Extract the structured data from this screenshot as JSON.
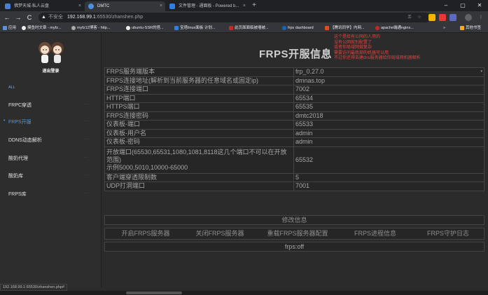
{
  "browser": {
    "tabs": [
      {
        "title": "佛梦天城-私人云盘",
        "icon_color": "#4a7fd8",
        "close": "×"
      },
      {
        "title": "DMTC",
        "icon_color": "#4a90e2",
        "close": "×"
      },
      {
        "title": "文件管理 - 通面板 - Powered b...",
        "icon_color": "#2d7fe0",
        "close": "×"
      }
    ],
    "new_tab": "+",
    "window_controls": [
      "–",
      "▢",
      "✕"
    ],
    "nav": {
      "back": "←",
      "forward": "→",
      "reload": "C"
    },
    "address": {
      "security": "不安全",
      "host": "192.168.99.1",
      "path": ":65530/zhanshen.php"
    },
    "bookmarks": [
      {
        "label": "应用",
        "color": "#5f8fd6"
      },
      {
        "label": "摸鱼时文章 - myfz...",
        "color": "#3b3b3b"
      },
      {
        "label": "myfz12博客 - http...",
        "color": "#888"
      },
      {
        "label": "ubuntu-SSR的搭...",
        "color": "#555"
      },
      {
        "label": "宝塔linux面板 计划...",
        "color": "#2d7fe0"
      },
      {
        "label": "此页面面临被墙被...",
        "color": "#c62828"
      },
      {
        "label": "frps dashboard",
        "color": "#1565c0"
      },
      {
        "label": "【腾讯同学】内网...",
        "color": "#e64a19"
      },
      {
        "label": "apache端通nginx...",
        "color": "#c62828"
      },
      {
        "label": "»",
        "color": "#35363a"
      },
      {
        "label": "其他书签",
        "color": "#f9a825"
      }
    ]
  },
  "sidebar": {
    "logout": "退出登录",
    "items": [
      {
        "label": "ALL",
        "small": true,
        "active": false
      },
      {
        "label": "FRPC穿透",
        "small": false,
        "active": false
      },
      {
        "label": "FRPS开服",
        "small": false,
        "active": true
      },
      {
        "label": "DDNS动态解析",
        "small": false,
        "active": false
      },
      {
        "label": "酸奶代理",
        "small": false,
        "active": false
      },
      {
        "label": "酸奶库",
        "small": false,
        "active": false
      },
      {
        "label": "FRPS库",
        "small": false,
        "active": false
      }
    ],
    "dots": "·····"
  },
  "main": {
    "title": "FRPS开服信息",
    "note": "这个是给有公网的人用的\n没有公网就别配置了\n或者你局域网做复杂\n需要访问最底部的机器可以用\n不过你还得去建dns服务器给你局域网机器解析",
    "rows": [
      {
        "label": "FRPS服务端版本",
        "value": "frp_0.27.0",
        "select": true
      },
      {
        "label": "FRPS连接地址(解析到当前服务器的任意域名或固定ip)",
        "value": "dmnas.top"
      },
      {
        "label": "FRPS连接端口",
        "value": "7002"
      },
      {
        "label": "HTTP端口",
        "value": "65534"
      },
      {
        "label": "HTTPS端口",
        "value": "65535"
      },
      {
        "label": "FRPS连接密码",
        "value": "dmtc2018"
      },
      {
        "label": "仪表板-端口",
        "value": "65533"
      },
      {
        "label": "仪表板-用户名",
        "value": "admin"
      },
      {
        "label": "仪表板-密码",
        "value": "admin"
      },
      {
        "label": "开放端口(65530,65531,1080,1081,8118这几个端口不可以在开放范围)\n示例5000,5010,10000-65000",
        "value": "65532",
        "tall": true
      },
      {
        "label": "客户端穿透限制数",
        "value": "5"
      },
      {
        "label": "UDP打洞端口",
        "value": "7001"
      }
    ],
    "save_label": "修改信息",
    "buttons": [
      "开启FRPS服务器",
      "关闭FRPS服务器",
      "重载FRPS服务器配置",
      "FRPS进程信息",
      "FRPS守护日志"
    ],
    "status": "frps:off"
  },
  "statusbar": {
    "url": "192.168.99.1:65530/zhanshen.php#"
  }
}
